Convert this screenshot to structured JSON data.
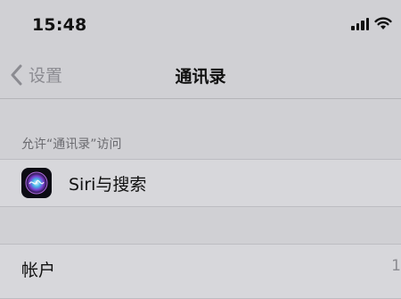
{
  "status_bar": {
    "time": "15:48",
    "icons": [
      "signal-icon",
      "wifi-icon"
    ]
  },
  "nav": {
    "back_label": "设置",
    "title": "通讯录"
  },
  "sections": {
    "allow_access_header": "允许“通讯录”访问",
    "siri_row_label": "Siri与搜索",
    "accounts_label": "帐户",
    "accounts_value": "1"
  },
  "colors": {
    "background": "#d0d0d4",
    "row_background": "#d7d7db",
    "secondary_text": "#8b8b91"
  }
}
